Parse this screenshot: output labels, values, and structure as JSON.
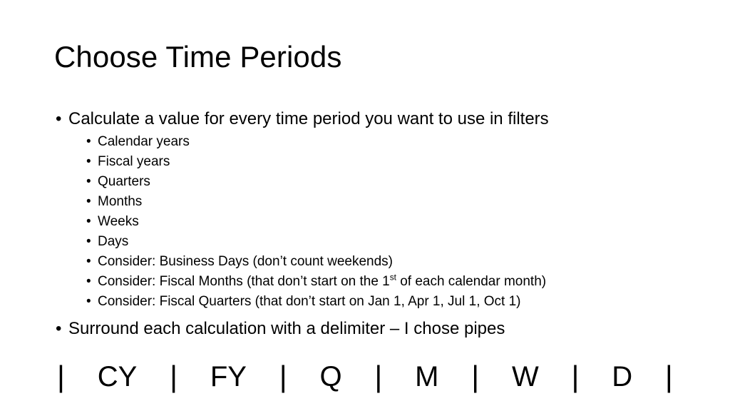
{
  "slide": {
    "title": "Choose Time Periods",
    "bullets": [
      {
        "text": "Calculate a value for every time period you want to use in filters",
        "marker": "•",
        "children": [
          {
            "text": "Calendar years",
            "marker": "•"
          },
          {
            "text": "Fiscal years",
            "marker": "•"
          },
          {
            "text": "Quarters",
            "marker": "•"
          },
          {
            "text": "Months",
            "marker": "•"
          },
          {
            "text": "Weeks",
            "marker": "•"
          },
          {
            "text": "Days",
            "marker": "•"
          },
          {
            "text": "Consider: Business Days (don’t count weekends)",
            "marker": "•"
          },
          {
            "text_before": "Consider: Fiscal Months (that don’t start on the 1",
            "superscript": "st",
            "text_after": " of each calendar month)",
            "marker": "•"
          },
          {
            "text": "Consider: Fiscal Quarters (that don’t start on Jan 1, Apr 1, Jul 1, Oct 1)",
            "marker": "•"
          }
        ]
      },
      {
        "text": "Surround each calculation with a delimiter – I chose pipes",
        "marker": "•"
      }
    ],
    "delimiter_row": {
      "pipe": "|",
      "tokens": [
        "CY",
        "FY",
        "Q",
        "M",
        "W",
        "D"
      ],
      "full_text": "|   CY   |   FY   |   Q   |   M   |   W   |   D   |"
    },
    "colors": {
      "background": "#ffffff",
      "text": "#000000"
    }
  }
}
